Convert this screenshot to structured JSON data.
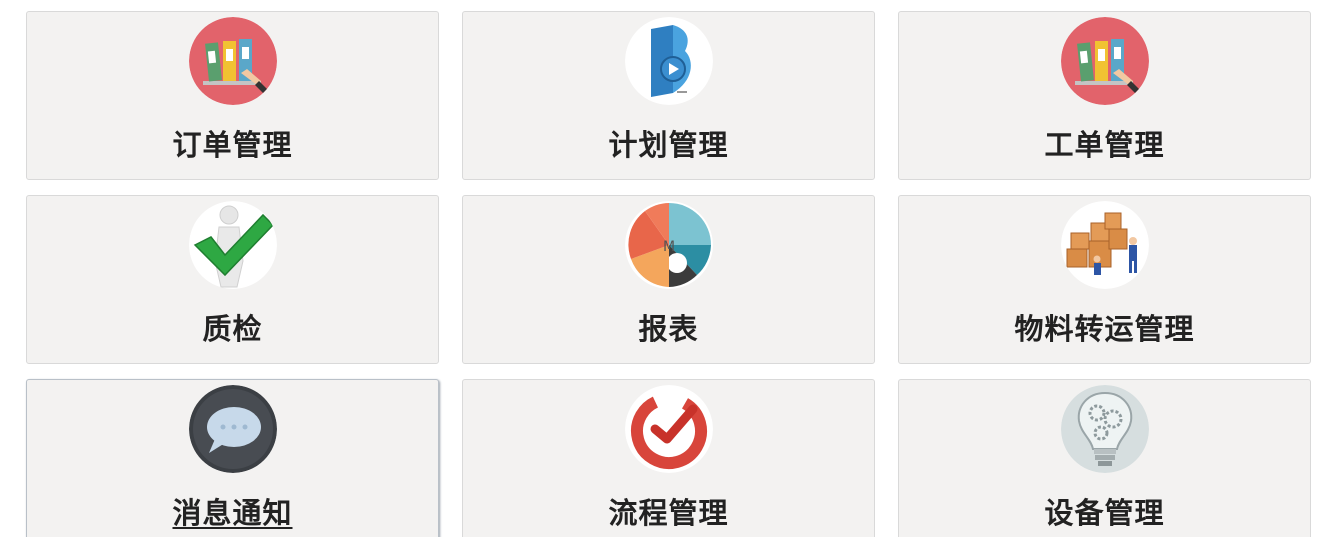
{
  "tiles": [
    {
      "label": "订单管理",
      "icon": "binders-icon"
    },
    {
      "label": "计划管理",
      "icon": "blue-book-icon"
    },
    {
      "label": "工单管理",
      "icon": "binders-icon"
    },
    {
      "label": "质检",
      "icon": "checkmark-figure-icon"
    },
    {
      "label": "报表",
      "icon": "pie-chart-icon"
    },
    {
      "label": "物料转运管理",
      "icon": "boxes-movers-icon"
    },
    {
      "label": "消息通知",
      "icon": "chat-bubble-icon"
    },
    {
      "label": "流程管理",
      "icon": "red-check-icon"
    },
    {
      "label": "设备管理",
      "icon": "gear-bulb-icon"
    }
  ],
  "colors": {
    "tile_bg": "#f3f2f1",
    "tile_border": "#d9d9d9",
    "label": "#222222"
  }
}
